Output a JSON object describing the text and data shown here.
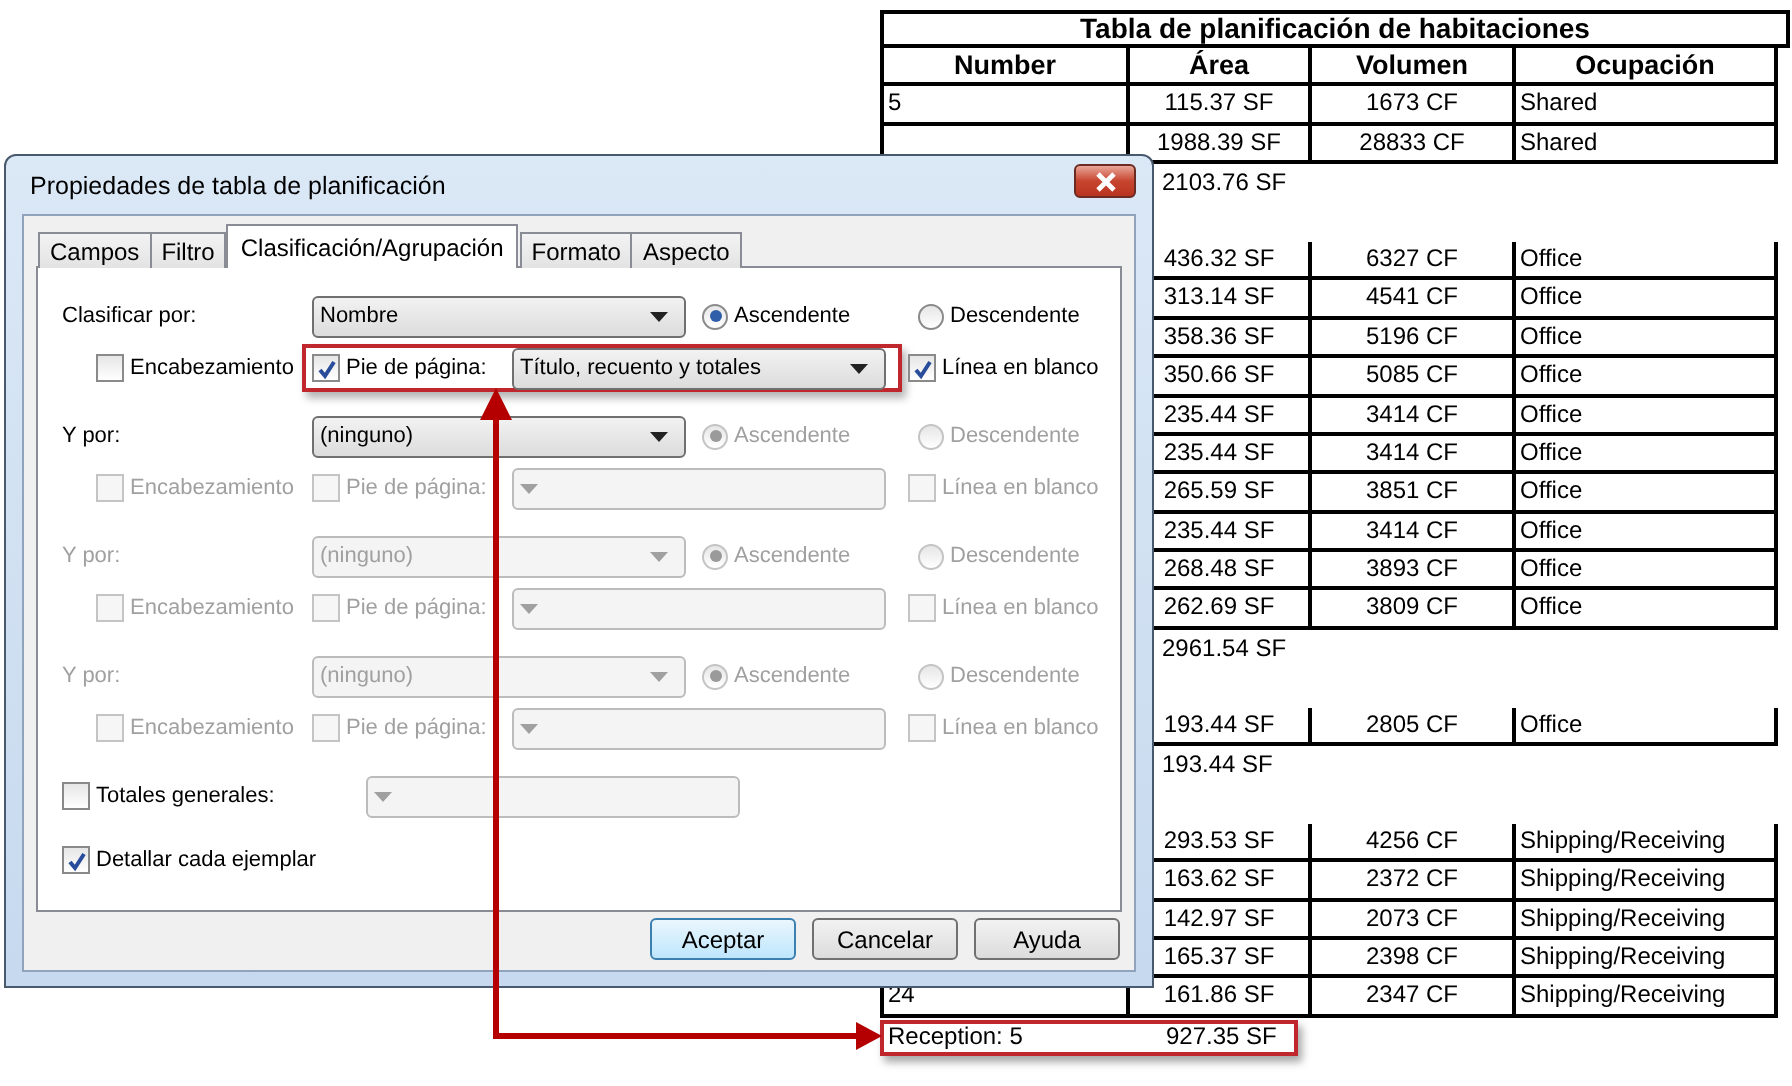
{
  "schedule": {
    "title": "Tabla de planificación de habitaciones",
    "columns": [
      "Number",
      "Área",
      "Volumen",
      "Ocupación"
    ],
    "rows": [
      {
        "kind": "data",
        "number": "5",
        "area": "115.37 SF",
        "volume": "1673 CF",
        "occupancy": "Shared"
      },
      {
        "kind": "data",
        "area": "1988.39 SF",
        "volume": "28833 CF",
        "occupancy": "Shared"
      },
      {
        "kind": "total",
        "area": "2103.76 SF",
        "highlighted": false
      },
      {
        "kind": "blank"
      },
      {
        "kind": "data",
        "area": "436.32 SF",
        "volume": "6327 CF",
        "occupancy": "Office"
      },
      {
        "kind": "data",
        "area": "313.14 SF",
        "volume": "4541 CF",
        "occupancy": "Office"
      },
      {
        "kind": "data",
        "area": "358.36 SF",
        "volume": "5196 CF",
        "occupancy": "Office"
      },
      {
        "kind": "data",
        "area": "350.66 SF",
        "volume": "5085 CF",
        "occupancy": "Office"
      },
      {
        "kind": "data",
        "area": "235.44 SF",
        "volume": "3414 CF",
        "occupancy": "Office"
      },
      {
        "kind": "data",
        "area": "235.44 SF",
        "volume": "3414 CF",
        "occupancy": "Office"
      },
      {
        "kind": "data",
        "area": "265.59 SF",
        "volume": "3851 CF",
        "occupancy": "Office"
      },
      {
        "kind": "data",
        "area": "235.44 SF",
        "volume": "3414 CF",
        "occupancy": "Office"
      },
      {
        "kind": "data",
        "area": "268.48 SF",
        "volume": "3893 CF",
        "occupancy": "Office"
      },
      {
        "kind": "data",
        "area": "262.69 SF",
        "volume": "3809 CF",
        "occupancy": "Office"
      },
      {
        "kind": "total",
        "area": "2961.54 SF",
        "highlighted": false
      },
      {
        "kind": "blank"
      },
      {
        "kind": "data",
        "area": "193.44 SF",
        "volume": "2805 CF",
        "occupancy": "Office"
      },
      {
        "kind": "total",
        "area": "193.44 SF",
        "highlighted": false
      },
      {
        "kind": "blank"
      },
      {
        "kind": "data",
        "area": "293.53 SF",
        "volume": "4256 CF",
        "occupancy": "Shipping/Receiving"
      },
      {
        "kind": "data",
        "area": "163.62 SF",
        "volume": "2372 CF",
        "occupancy": "Shipping/Receiving"
      },
      {
        "kind": "data",
        "area": "142.97 SF",
        "volume": "2073 CF",
        "occupancy": "Shipping/Receiving"
      },
      {
        "kind": "data",
        "area": "165.37 SF",
        "volume": "2398 CF",
        "occupancy": "Shipping/Receiving"
      },
      {
        "kind": "data",
        "number": "24",
        "area": "161.86 SF",
        "volume": "2347 CF",
        "occupancy": "Shipping/Receiving"
      },
      {
        "kind": "total",
        "label": "Reception: 5",
        "area": "927.35 SF",
        "highlighted": true
      }
    ]
  },
  "dialog": {
    "title": "Propiedades de tabla de planificación",
    "tabs": [
      {
        "label": "Campos",
        "selected": false
      },
      {
        "label": "Filtro",
        "selected": false
      },
      {
        "label": "Clasificación/Agrupación",
        "selected": true
      },
      {
        "label": "Formato",
        "selected": false
      },
      {
        "label": "Aspecto",
        "selected": false
      }
    ],
    "sort_groups": [
      {
        "label": "Clasificar por:",
        "value": "Nombre",
        "disabled": false,
        "options_disabled": false,
        "order": [
          {
            "label": "Ascendente",
            "selected": true
          },
          {
            "label": "Descendente",
            "selected": false
          }
        ],
        "header": {
          "label": "Encabezamiento",
          "checked": false
        },
        "footer": {
          "label": "Pie de página:",
          "checked": true,
          "value": "Título, recuento y totales",
          "highlighted": true
        },
        "blank_line": {
          "label": "Línea en blanco",
          "checked": true
        }
      },
      {
        "label": "Y por:",
        "value": "(ninguno)",
        "disabled": false,
        "options_disabled": true,
        "order": [
          {
            "label": "Ascendente",
            "selected": true
          },
          {
            "label": "Descendente",
            "selected": false
          }
        ],
        "header": {
          "label": "Encabezamiento",
          "checked": false
        },
        "footer": {
          "label": "Pie de página:",
          "checked": false,
          "highlighted": false
        },
        "blank_line": {
          "label": "Línea en blanco",
          "checked": false
        }
      },
      {
        "label": "Y por:",
        "value": "(ninguno)",
        "disabled": true,
        "options_disabled": true,
        "order": [
          {
            "label": "Ascendente",
            "selected": true
          },
          {
            "label": "Descendente",
            "selected": false
          }
        ],
        "header": {
          "label": "Encabezamiento",
          "checked": false
        },
        "footer": {
          "label": "Pie de página:",
          "checked": false,
          "highlighted": false
        },
        "blank_line": {
          "label": "Línea en blanco",
          "checked": false
        }
      },
      {
        "label": "Y por:",
        "value": "(ninguno)",
        "disabled": true,
        "options_disabled": true,
        "order": [
          {
            "label": "Ascendente",
            "selected": true
          },
          {
            "label": "Descendente",
            "selected": false
          }
        ],
        "header": {
          "label": "Encabezamiento",
          "checked": false
        },
        "footer": {
          "label": "Pie de página:",
          "checked": false,
          "highlighted": false
        },
        "blank_line": {
          "label": "Línea en blanco",
          "checked": false
        }
      }
    ],
    "grand_totals": {
      "label": "Totales generales:",
      "checked": false
    },
    "itemize": {
      "label": "Detallar cada ejemplar",
      "checked": true
    },
    "buttons": [
      {
        "label": "Aceptar",
        "default": true
      },
      {
        "label": "Cancelar",
        "default": false
      },
      {
        "label": "Ayuda",
        "default": false
      }
    ]
  }
}
